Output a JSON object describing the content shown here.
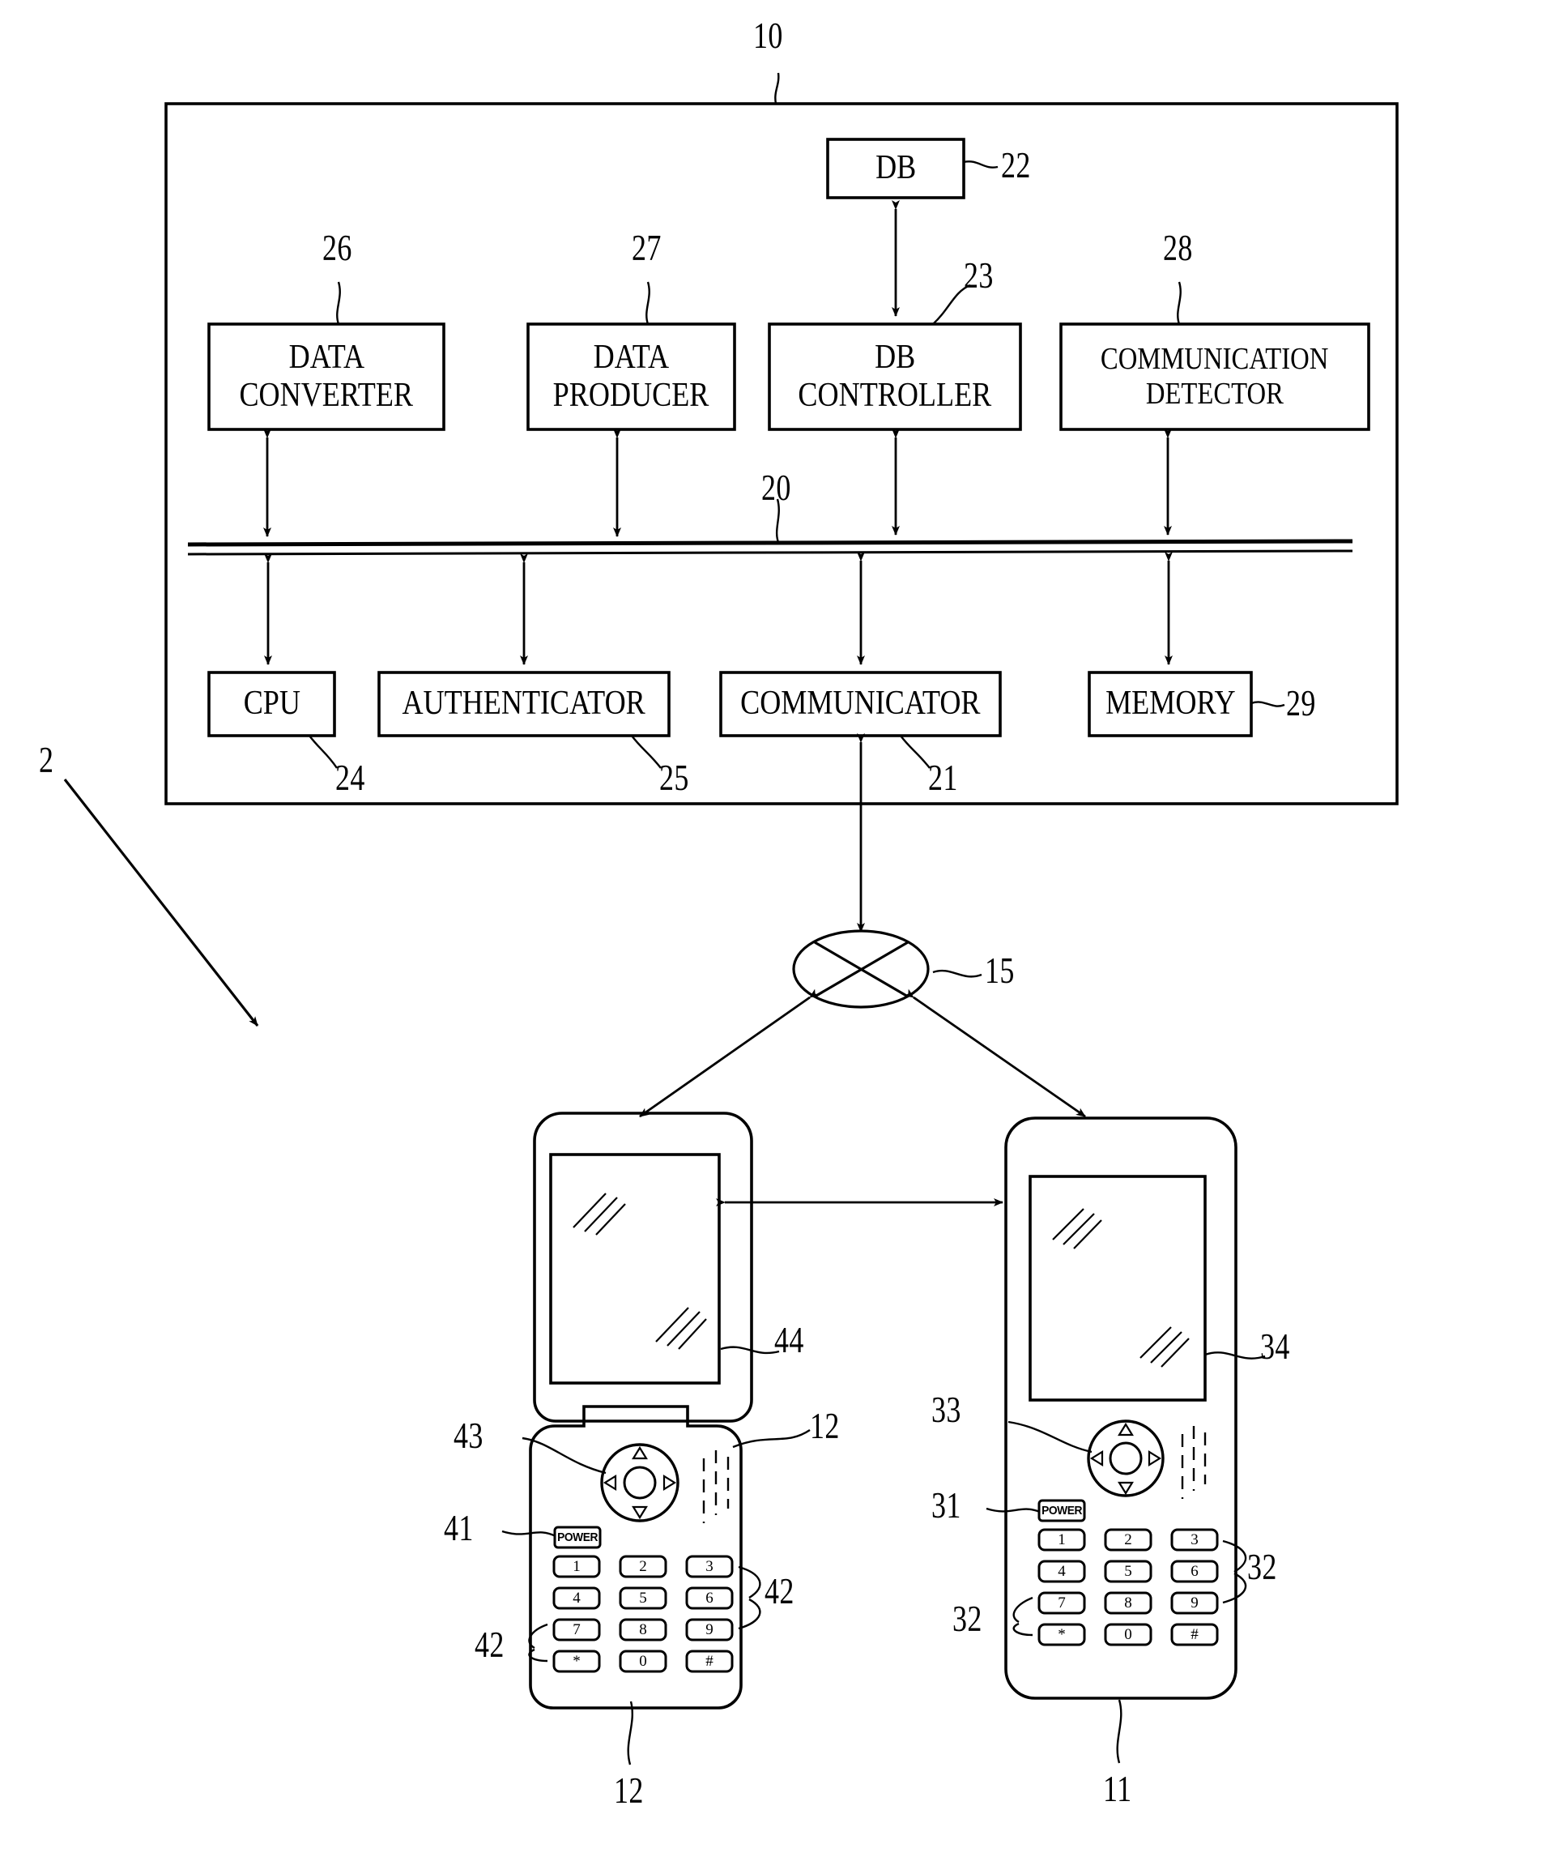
{
  "figure": {
    "type": "patent-block-diagram",
    "overall_ref": "2",
    "server_ref": "10",
    "bus_ref": "20",
    "network_ref": "15"
  },
  "server": {
    "label_ref": "10",
    "bus_label": "20",
    "db": {
      "label": "DB",
      "ref": "22"
    },
    "upper_blocks": [
      {
        "line1": "DATA",
        "line2": "CONVERTER",
        "ref": "26"
      },
      {
        "line1": "DATA",
        "line2": "PRODUCER",
        "ref": "27"
      },
      {
        "line1": "DB",
        "line2": "CONTROLLER",
        "ref": "23"
      },
      {
        "line1": "COMMUNICATION",
        "line2": "DETECTOR",
        "ref": "28"
      }
    ],
    "lower_blocks": [
      {
        "line1": "CPU",
        "ref": "24"
      },
      {
        "line1": "AUTHENTICATOR",
        "ref": "25"
      },
      {
        "line1": "COMMUNICATOR",
        "ref": "21"
      },
      {
        "line1": "MEMORY",
        "ref": "29"
      }
    ]
  },
  "network": {
    "ref": "15",
    "icon": "crossed-ellipse-network-icon"
  },
  "phones": [
    {
      "name": "flip-phone",
      "body_ref": "12",
      "body_ref_bottom": "12",
      "display_ref": "44",
      "navpad_ref": "43",
      "power_ref": "41",
      "keypad_refs": [
        "42",
        "42"
      ],
      "power_label": "POWER",
      "keys": [
        [
          "1",
          "2",
          "3"
        ],
        [
          "4",
          "5",
          "6"
        ],
        [
          "7",
          "8",
          "9"
        ],
        [
          "*",
          "0",
          "#"
        ]
      ]
    },
    {
      "name": "bar-phone",
      "body_ref": "11",
      "display_ref": "34",
      "navpad_ref": "33",
      "power_ref": "31",
      "keypad_refs": [
        "32",
        "32"
      ],
      "power_label": "POWER",
      "keys": [
        [
          "1",
          "2",
          "3"
        ],
        [
          "4",
          "5",
          "6"
        ],
        [
          "7",
          "8",
          "9"
        ],
        [
          "*",
          "0",
          "#"
        ]
      ]
    }
  ],
  "refnums": {
    "n2": "2",
    "n10": "10",
    "n11": "11",
    "n12a": "12",
    "n12b": "12",
    "n15": "15",
    "n20": "20",
    "n21": "21",
    "n22": "22",
    "n23": "23",
    "n24": "24",
    "n25": "25",
    "n26": "26",
    "n27": "27",
    "n28": "28",
    "n29": "29",
    "n31": "31",
    "n32a": "32",
    "n32b": "32",
    "n33": "33",
    "n34": "34",
    "n41": "41",
    "n42a": "42",
    "n42b": "42",
    "n43": "43",
    "n44": "44"
  },
  "colors": {
    "ink": "#000000",
    "paper": "#ffffff"
  }
}
